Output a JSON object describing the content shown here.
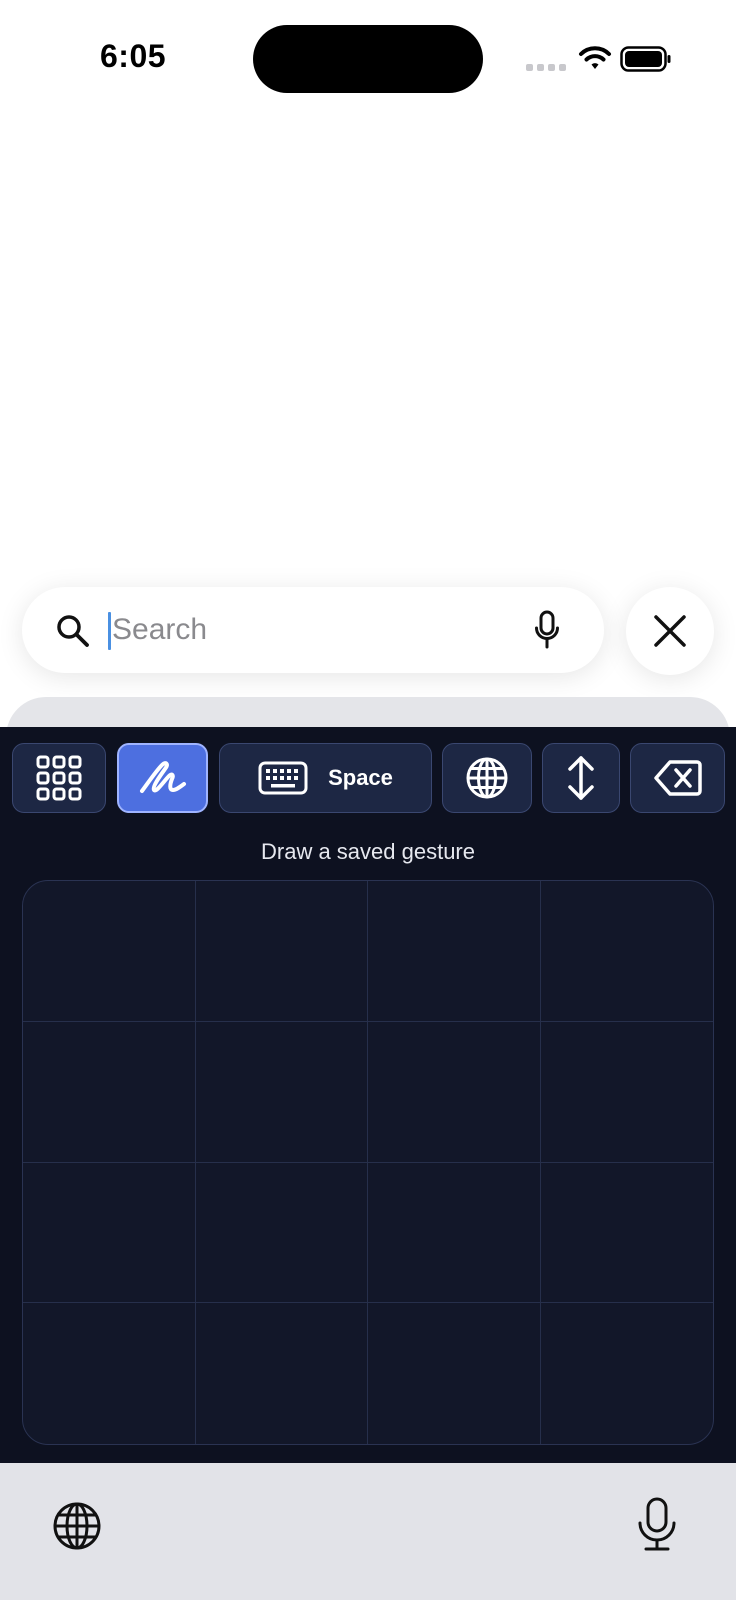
{
  "status_bar": {
    "time": "6:05",
    "icons": [
      "cellular-signal-icon",
      "wifi-icon",
      "battery-icon"
    ]
  },
  "search": {
    "placeholder": "Search",
    "value": "",
    "icons": [
      "search-icon",
      "microphone-icon"
    ],
    "close_icon": "close-icon"
  },
  "keyboard": {
    "toolbar": [
      {
        "icon": "grid-icon",
        "label": ""
      },
      {
        "icon": "handwriting-icon",
        "label": "",
        "active": true
      },
      {
        "icon": "keyboard-icon",
        "label": "Space"
      },
      {
        "icon": "globe-icon",
        "label": ""
      },
      {
        "icon": "vertical-arrows-icon",
        "label": ""
      },
      {
        "icon": "backspace-icon",
        "label": ""
      }
    ],
    "prompt": "Draw a saved gesture",
    "grid": {
      "rows": 4,
      "columns": 4
    }
  },
  "bottom_bar": {
    "icons": [
      "globe-icon",
      "microphone-icon"
    ]
  },
  "colors": {
    "keyboard_background": "#0d1120",
    "key_background": "#1d2744",
    "active_key": "#4d6fe0",
    "caret": "#4a90e2"
  }
}
